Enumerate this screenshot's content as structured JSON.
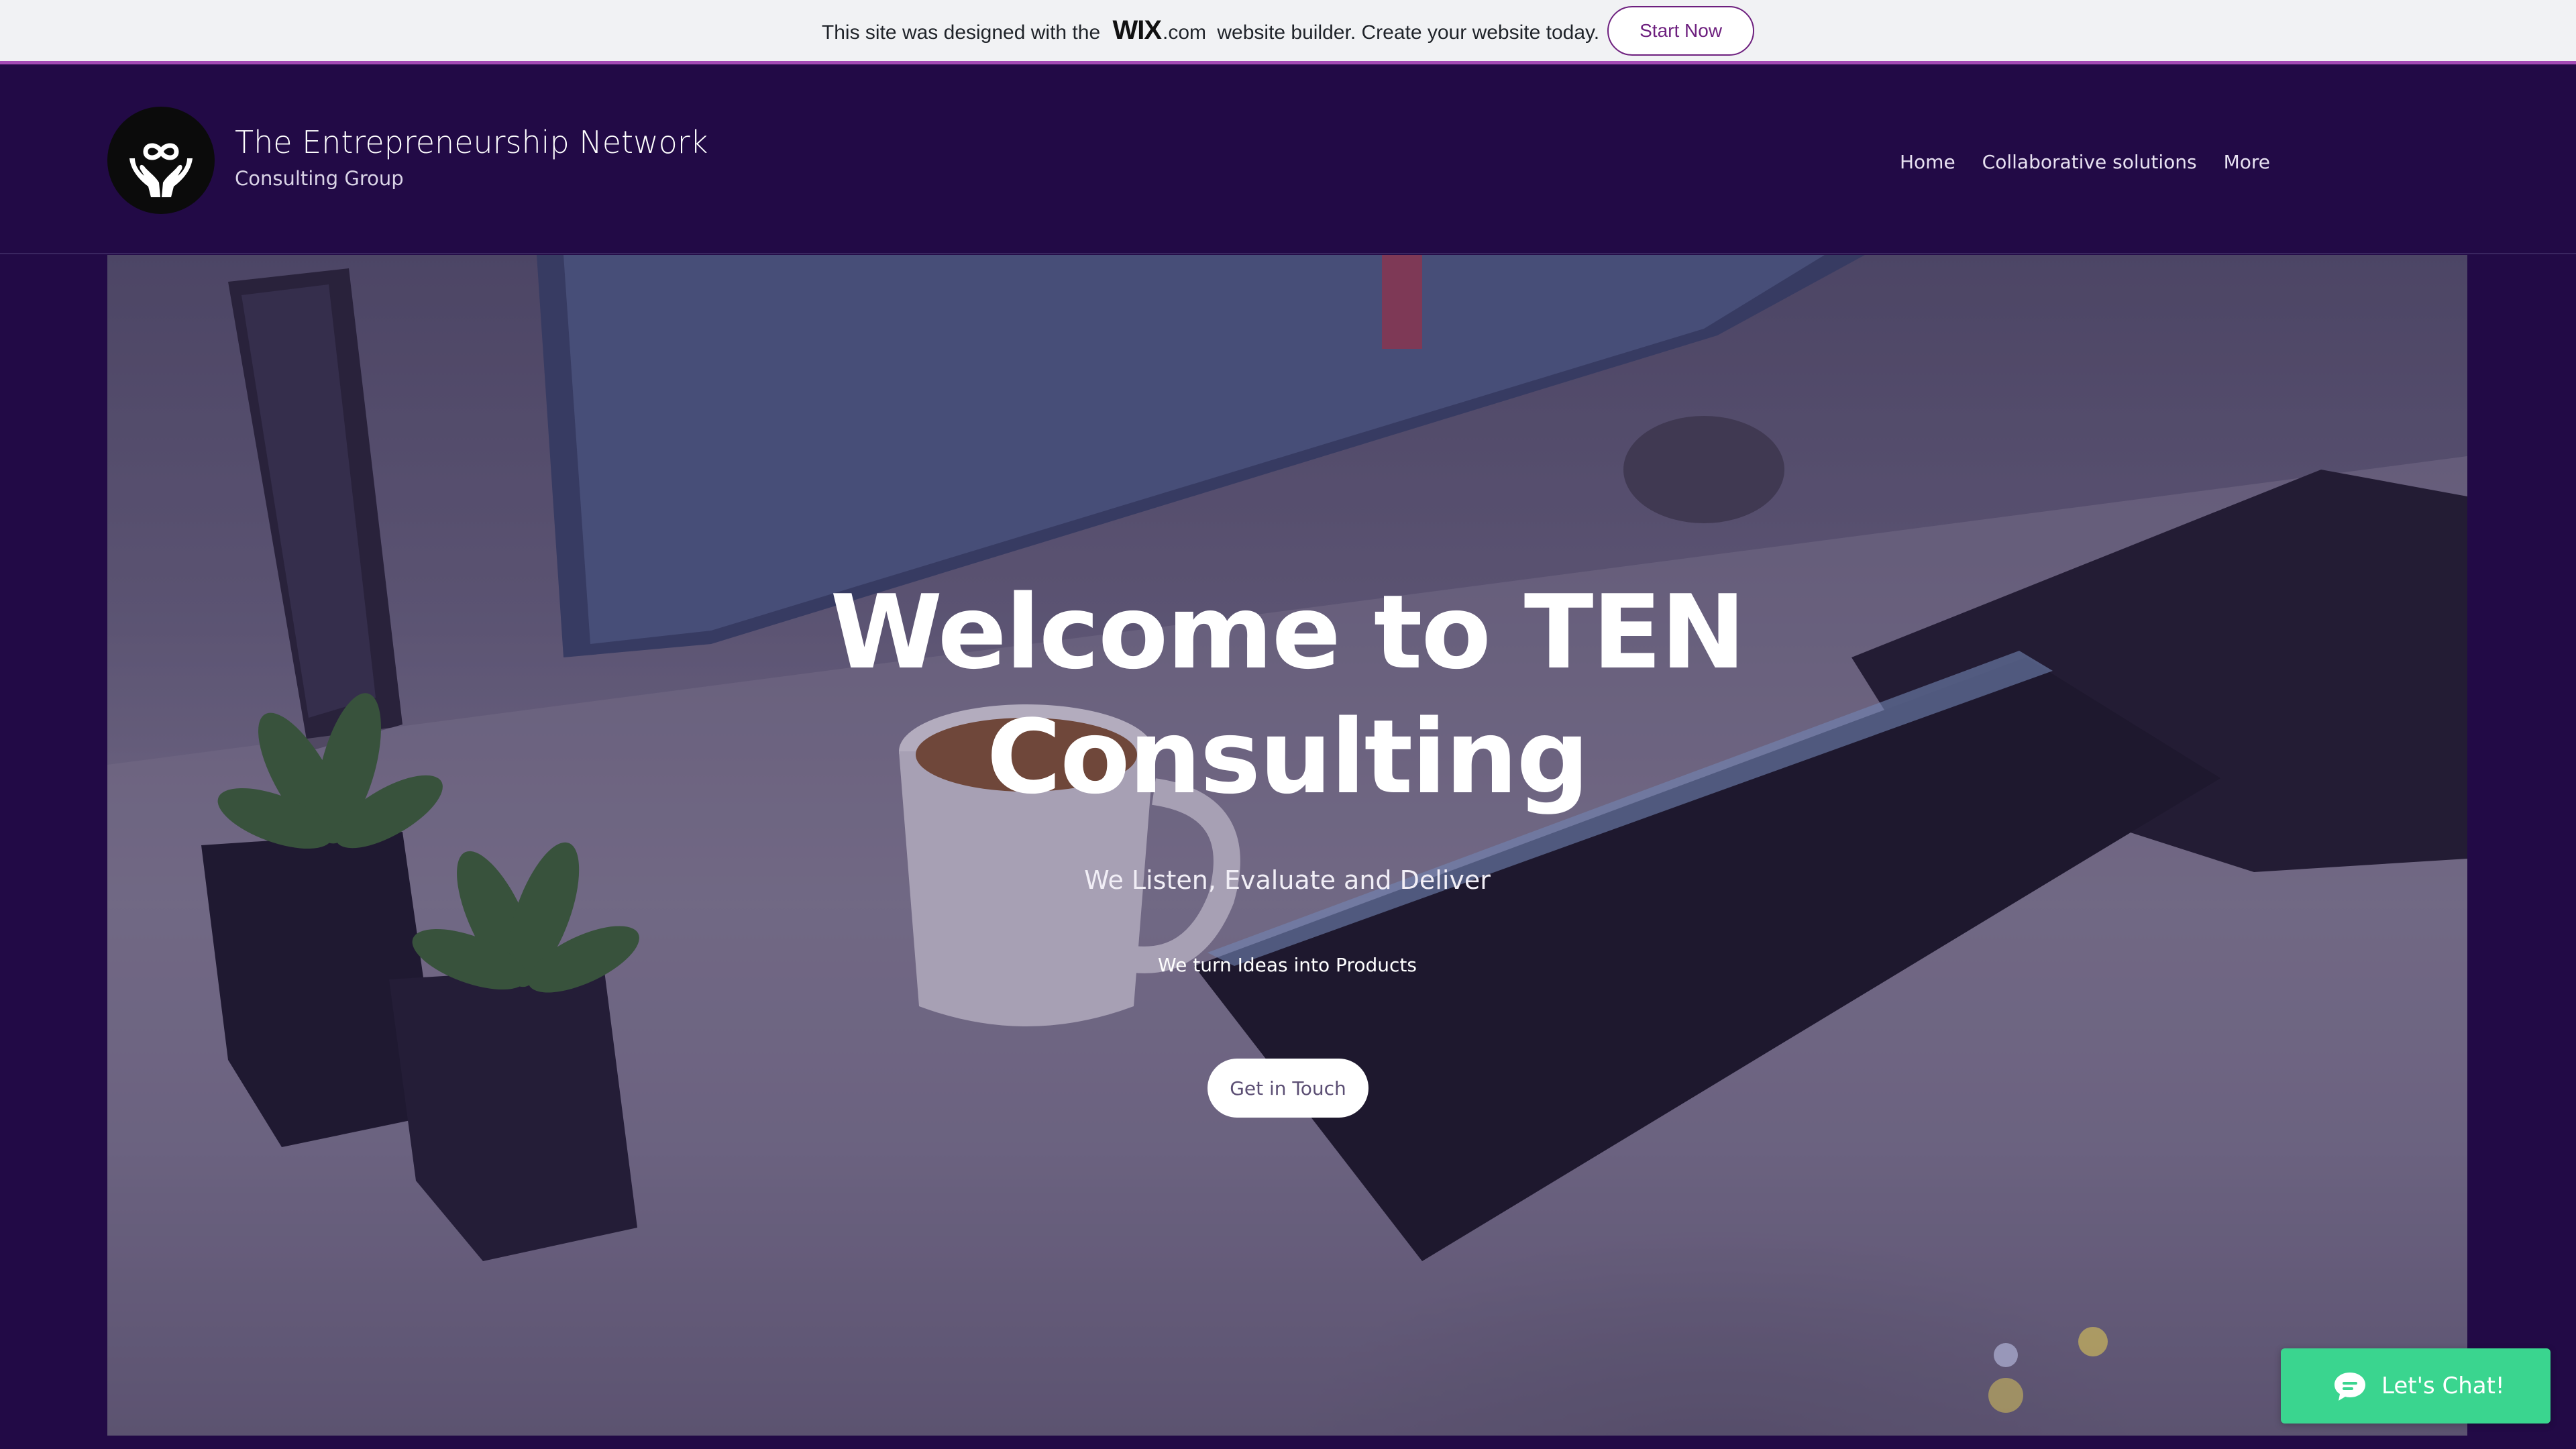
{
  "banner": {
    "text_before": "This site was designed with the ",
    "wix_logo": "WIX",
    "text_dotcom": ".com",
    "text_after": " website builder. Create your website today.",
    "cta_label": "Start Now"
  },
  "header": {
    "brand_title": "The Entrepreneurship Network",
    "brand_subtitle": "Consulting Group",
    "logo_icon": "hands-infinity-icon",
    "nav": [
      {
        "label": "Home"
      },
      {
        "label": "Collaborative solutions"
      },
      {
        "label": "More"
      }
    ]
  },
  "hero": {
    "title_line1": "Welcome to TEN",
    "title_line2": "Consulting",
    "tagline": "We Listen, Evaluate and Deliver",
    "subtext": "We turn Ideas into Products",
    "cta_label": "Get in Touch"
  },
  "chat": {
    "label": "Let's Chat!",
    "icon": "chat-bubble-icon"
  },
  "colors": {
    "page_bg": "#220a46",
    "banner_bg": "#f1f2f4",
    "banner_accent": "#a44bb5",
    "chat_bg": "#3ad58f"
  }
}
